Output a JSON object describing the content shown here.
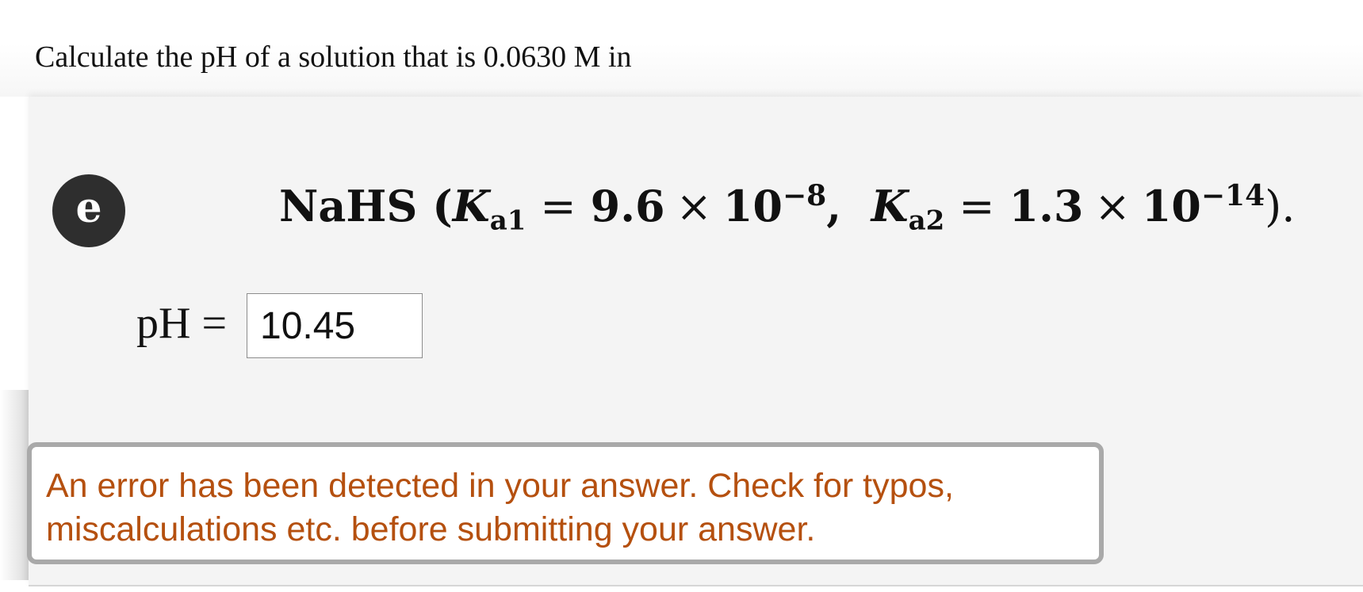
{
  "question": {
    "prompt": "Calculate the pH of a solution that is 0.0630 M in"
  },
  "part": {
    "badge": "e",
    "equation": {
      "compound": "NaHS",
      "open_paren": "(",
      "k_symbol": "K",
      "k1_sub": "a1",
      "equals": "=",
      "k1_mantissa": "9.6",
      "times": "×",
      "base": "10",
      "k1_exponent": "−8",
      "comma": ",",
      "k2_sub": "a2",
      "k2_mantissa": "1.3",
      "k2_exponent": "−14",
      "close": ")."
    },
    "answer_label": "pH =",
    "answer_value": "10.45"
  },
  "feedback": {
    "message": "An error has been detected in your answer. Check for typos, miscalculations etc. before submitting your answer.",
    "color": "#b5500f"
  }
}
